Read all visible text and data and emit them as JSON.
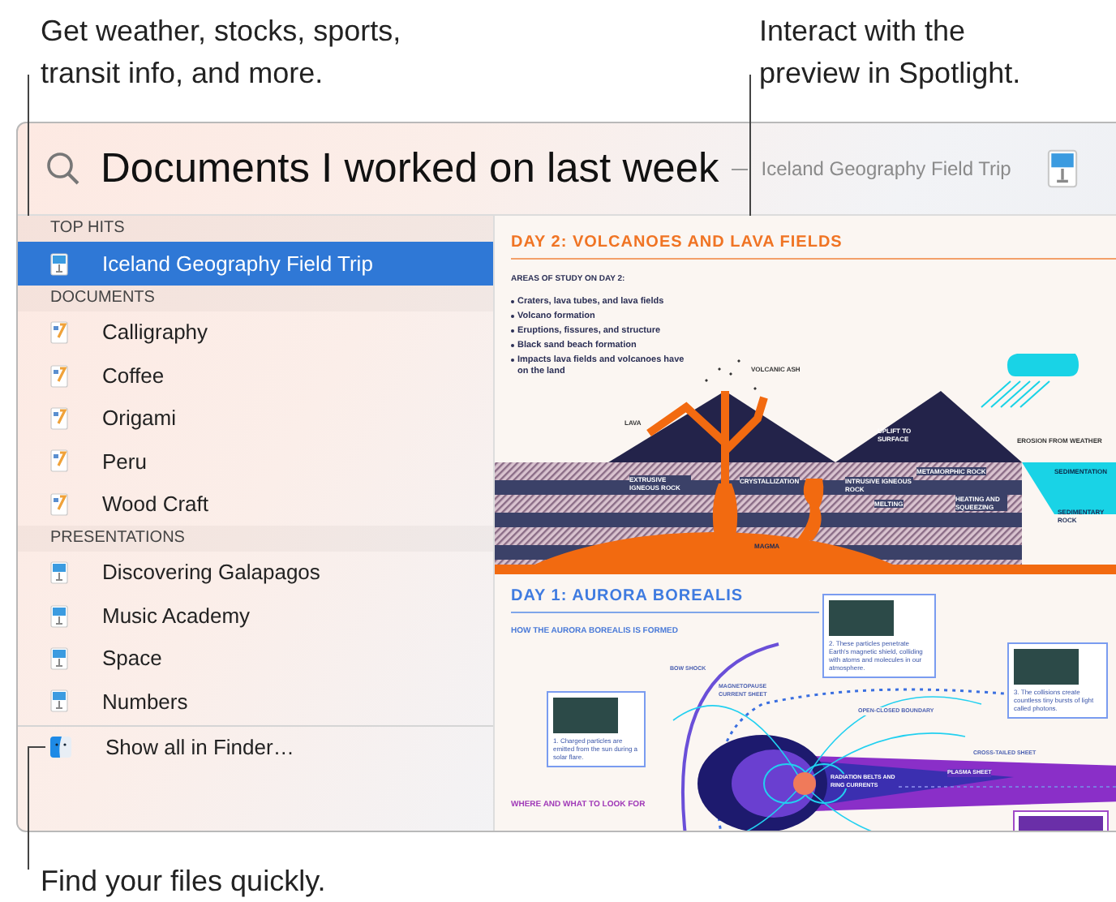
{
  "callouts": [
    {
      "text": "Get weather, stocks, sports, transit info, and more."
    },
    {
      "text": "Interact with the preview in Spotlight."
    },
    {
      "text": "Find your files quickly."
    }
  ],
  "search": {
    "query": "Documents I worked on last week",
    "hint": "Iceland Geography Field Trip"
  },
  "sections": [
    {
      "title": "TOP HITS",
      "items": [
        {
          "label": "Iceland Geography Field Trip",
          "kind": "presentation",
          "selected": true
        }
      ]
    },
    {
      "title": "DOCUMENTS",
      "items": [
        {
          "label": "Calligraphy",
          "kind": "document",
          "selected": false
        },
        {
          "label": "Coffee",
          "kind": "document",
          "selected": false
        },
        {
          "label": "Origami",
          "kind": "document",
          "selected": false
        },
        {
          "label": "Peru",
          "kind": "document",
          "selected": false
        },
        {
          "label": "Wood Craft",
          "kind": "document",
          "selected": false
        }
      ]
    },
    {
      "title": "PRESENTATIONS",
      "items": [
        {
          "label": "Discovering Galapagos",
          "kind": "presentation",
          "selected": false
        },
        {
          "label": "Music Academy",
          "kind": "presentation",
          "selected": false
        },
        {
          "label": "Space",
          "kind": "presentation",
          "selected": false
        },
        {
          "label": "Numbers",
          "kind": "presentation",
          "selected": false
        }
      ]
    }
  ],
  "footer": {
    "label": "Show all in Finder…"
  },
  "preview": {
    "slides": [
      {
        "kind": "volcano",
        "title": "DAY 2: VOLCANOES AND LAVA FIELDS",
        "subtitle": "AREAS OF STUDY ON DAY 2:",
        "bullets": [
          "Craters, lava tubes, and lava fields",
          "Volcano formation",
          "Eruptions, fissures, and structure",
          "Black sand beach formation",
          "Impacts lava fields and volcanoes have on the land"
        ],
        "labels": [
          "VOLCANIC ASH",
          "LAVA",
          "UPLIFT TO SURFACE",
          "EROSION FROM WEATHER",
          "SEDIMENTATION",
          "EXTRUSIVE IGNEOUS ROCK",
          "CRYSTALLIZATION",
          "INTRUSIVE IGNEOUS ROCK",
          "METAMORPHIC ROCK",
          "MELTING",
          "HEATING AND SQUEEZING",
          "SEDIMENTARY ROCK",
          "MAGMA"
        ]
      },
      {
        "kind": "aurora",
        "title": "DAY 1: AURORA BOREALIS",
        "subtitle": "HOW THE AURORA BOREALIS IS FORMED",
        "captions": [
          "1. Charged particles are emitted from the sun during a solar flare.",
          "2. These particles penetrate Earth's magnetic shield, colliding with atoms and molecules in our atmosphere.",
          "3. The collisions create countless tiny bursts of light called photons."
        ],
        "labels": [
          "BOW SHOCK",
          "MAGNETOPAUSE CURRENT SHEET",
          "OPEN-CLOSED BOUNDARY",
          "CROSS-TAILED SHEET",
          "PLASMA SHEET",
          "RADIATION BELTS AND RING CURRENTS"
        ],
        "heading2": "WHERE AND WHAT TO LOOK FOR"
      }
    ]
  }
}
